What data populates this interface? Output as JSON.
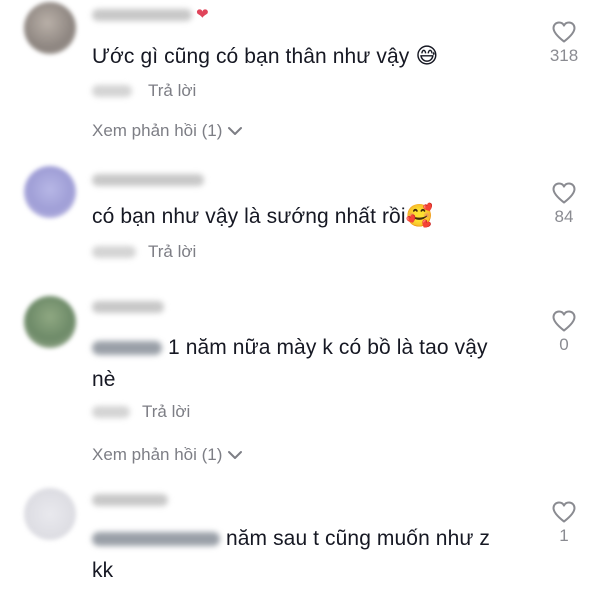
{
  "comments": [
    {
      "text": "Ước gì cũng có bạn thân như vậy",
      "emoji": "😅",
      "reply_label": "Trả lời",
      "likes": "318",
      "view_replies_label": "Xem phản hồi (1)"
    },
    {
      "text": "có bạn như vậy là sướng nhất rồi",
      "emoji": "🥰",
      "reply_label": "Trả lời",
      "likes": "84"
    },
    {
      "text": "1 năm nữa mày k có bồ là tao vậy nè",
      "reply_label": "Trả lời",
      "likes": "0",
      "view_replies_label": "Xem phản hồi (1)"
    },
    {
      "text": "năm sau t cũng muốn như z kk",
      "likes": "1"
    }
  ],
  "icons": {
    "like": "heart-outline-icon",
    "expand": "chevron-down-icon",
    "name_badge": "heart-icon"
  },
  "colors": {
    "text": "#161823",
    "muted": "#8a8b91",
    "name_badge": "#e0445a"
  }
}
